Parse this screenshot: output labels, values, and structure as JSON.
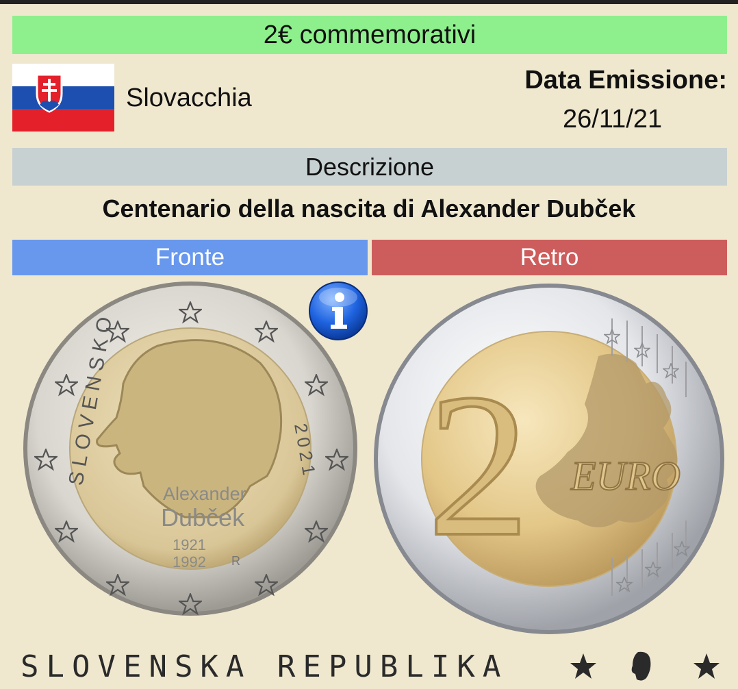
{
  "header": {
    "banner": "2€ commemorativi"
  },
  "country": {
    "name": "Slovacchia",
    "flag_icon": "slovakia-flag-icon"
  },
  "issue": {
    "label": "Data Emissione:",
    "date": "26/11/21"
  },
  "description": {
    "header": "Descrizione",
    "title": "Centenario della nascita di Alexander Dubček"
  },
  "tabs": {
    "front": "Fronte",
    "back": "Retro"
  },
  "colors": {
    "banner": "#8ef08c",
    "background": "#efe8cf",
    "description_bar": "#c8d1d1",
    "front_tab": "#6898ee",
    "back_tab": "#cd5d5c"
  },
  "front_coin": {
    "country_text": "SLOVENSKO",
    "year": "2021",
    "name_line1": "Alexander",
    "name_line2": "Dubček",
    "years_line1": "1921",
    "years_line2": "1992",
    "mint_mark": "R"
  },
  "back_coin": {
    "value": "2",
    "currency": "EURO"
  },
  "edge": {
    "inscription": "SLOVENSKA REPUBLIKA"
  }
}
